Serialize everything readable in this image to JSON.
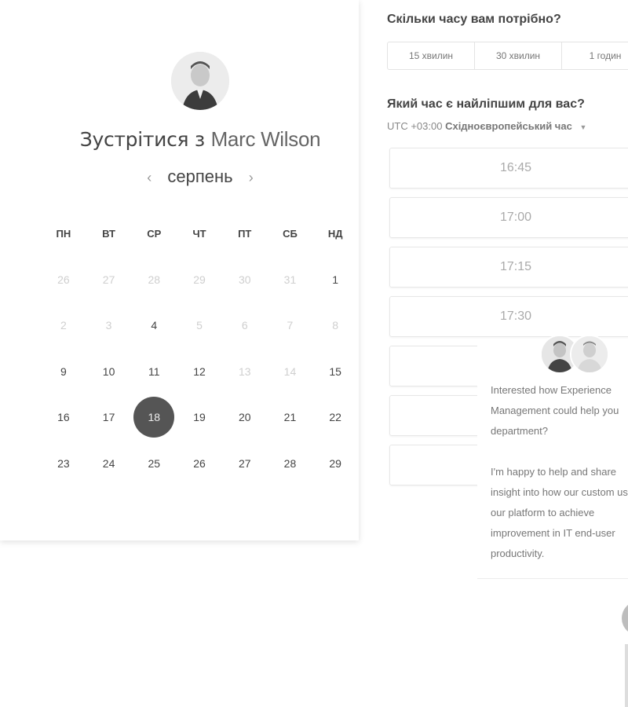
{
  "meeting": {
    "prefix": "Зустрітися з",
    "name": "Marc Wilson",
    "month": "серпень",
    "prev_icon": "‹",
    "next_icon": "›"
  },
  "calendar": {
    "weekdays": [
      "ПН",
      "ВТ",
      "СР",
      "ЧТ",
      "ПТ",
      "СБ",
      "НД"
    ],
    "weeks": [
      [
        {
          "d": "26",
          "s": "off"
        },
        {
          "d": "27",
          "s": "off"
        },
        {
          "d": "28",
          "s": "off"
        },
        {
          "d": "29",
          "s": "off"
        },
        {
          "d": "30",
          "s": "off"
        },
        {
          "d": "31",
          "s": "off"
        },
        {
          "d": "1",
          "s": "on"
        }
      ],
      [
        {
          "d": "2",
          "s": "na"
        },
        {
          "d": "3",
          "s": "na"
        },
        {
          "d": "4",
          "s": "on"
        },
        {
          "d": "5",
          "s": "na"
        },
        {
          "d": "6",
          "s": "na"
        },
        {
          "d": "7",
          "s": "na"
        },
        {
          "d": "8",
          "s": "na"
        }
      ],
      [
        {
          "d": "9",
          "s": "on"
        },
        {
          "d": "10",
          "s": "on"
        },
        {
          "d": "11",
          "s": "on"
        },
        {
          "d": "12",
          "s": "on"
        },
        {
          "d": "13",
          "s": "na"
        },
        {
          "d": "14",
          "s": "na"
        },
        {
          "d": "15",
          "s": "on"
        }
      ],
      [
        {
          "d": "16",
          "s": "on"
        },
        {
          "d": "17",
          "s": "on"
        },
        {
          "d": "18",
          "s": "sel"
        },
        {
          "d": "19",
          "s": "on"
        },
        {
          "d": "20",
          "s": "on"
        },
        {
          "d": "21",
          "s": "on"
        },
        {
          "d": "22",
          "s": "on"
        }
      ],
      [
        {
          "d": "23",
          "s": "on"
        },
        {
          "d": "24",
          "s": "on"
        },
        {
          "d": "25",
          "s": "on"
        },
        {
          "d": "26",
          "s": "on"
        },
        {
          "d": "27",
          "s": "on"
        },
        {
          "d": "28",
          "s": "on"
        },
        {
          "d": "29",
          "s": "on"
        }
      ]
    ]
  },
  "duration": {
    "question": "Скільки часу вам потрібно?",
    "options": [
      "15 хвилин",
      "30 хвилин",
      "1 годин"
    ]
  },
  "time": {
    "question": "Який час є найліпшим для вас?",
    "tz_offset": "UTC +03:00",
    "tz_name": "Східноєвропейський час",
    "slots": [
      "16:45",
      "17:00",
      "17:15",
      "17:30",
      "",
      "",
      ""
    ]
  },
  "chat": {
    "paragraph1": "Interested how Experience Management could help you department?",
    "paragraph2": "I'm happy to help and share insight into how our custom use our platform to achieve improvement in IT end-user productivity."
  }
}
